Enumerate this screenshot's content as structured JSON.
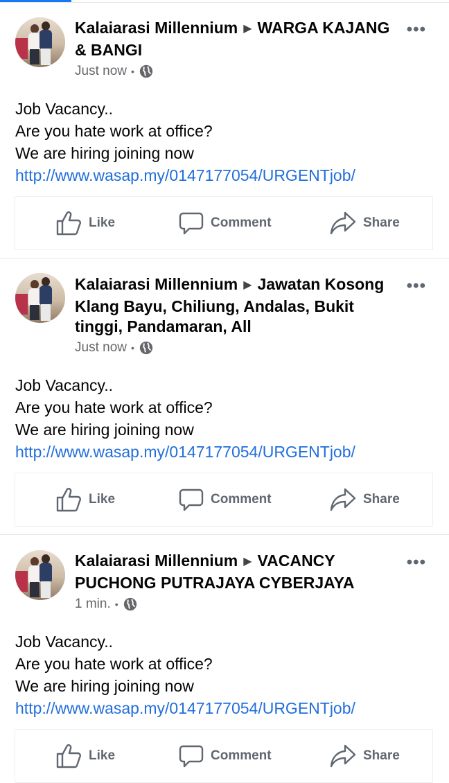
{
  "posts": [
    {
      "author": "Kalaiarasi Millennium",
      "group": "WARGA KAJANG & BANGI",
      "time": "Just now",
      "lines": [
        "Job Vacancy..",
        "Are you hate work at office?",
        "We are hiring joining now"
      ],
      "link": "http://www.wasap.my/0147177054/URGENTjob/"
    },
    {
      "author": "Kalaiarasi Millennium",
      "group": "Jawatan Kosong Klang Bayu, Chiliung, Andalas, Bukit tinggi, Pandamaran, All",
      "time": "Just now",
      "lines": [
        "Job Vacancy..",
        "Are you hate work at office?",
        "We are hiring joining now"
      ],
      "link": "http://www.wasap.my/0147177054/URGENTjob/"
    },
    {
      "author": "Kalaiarasi Millennium",
      "group": "VACANCY PUCHONG PUTRAJAYA CYBERJAYA",
      "time": "1 min.",
      "lines": [
        "Job Vacancy..",
        "Are you hate work at office?",
        "We are hiring joining now"
      ],
      "link": "http://www.wasap.my/0147177054/URGENTjob/"
    }
  ],
  "actions": {
    "like": "Like",
    "comment": "Comment",
    "share": "Share"
  },
  "icons": {
    "arrow": "triangle-right-icon",
    "audience": "globe-icon",
    "more": "more-dots-icon",
    "like": "thumbs-up-icon",
    "comment": "comment-bubble-icon",
    "share": "share-arrow-icon"
  },
  "colors": {
    "link": "#216fdb",
    "accent": "#1877f2",
    "muted": "#65676b"
  }
}
